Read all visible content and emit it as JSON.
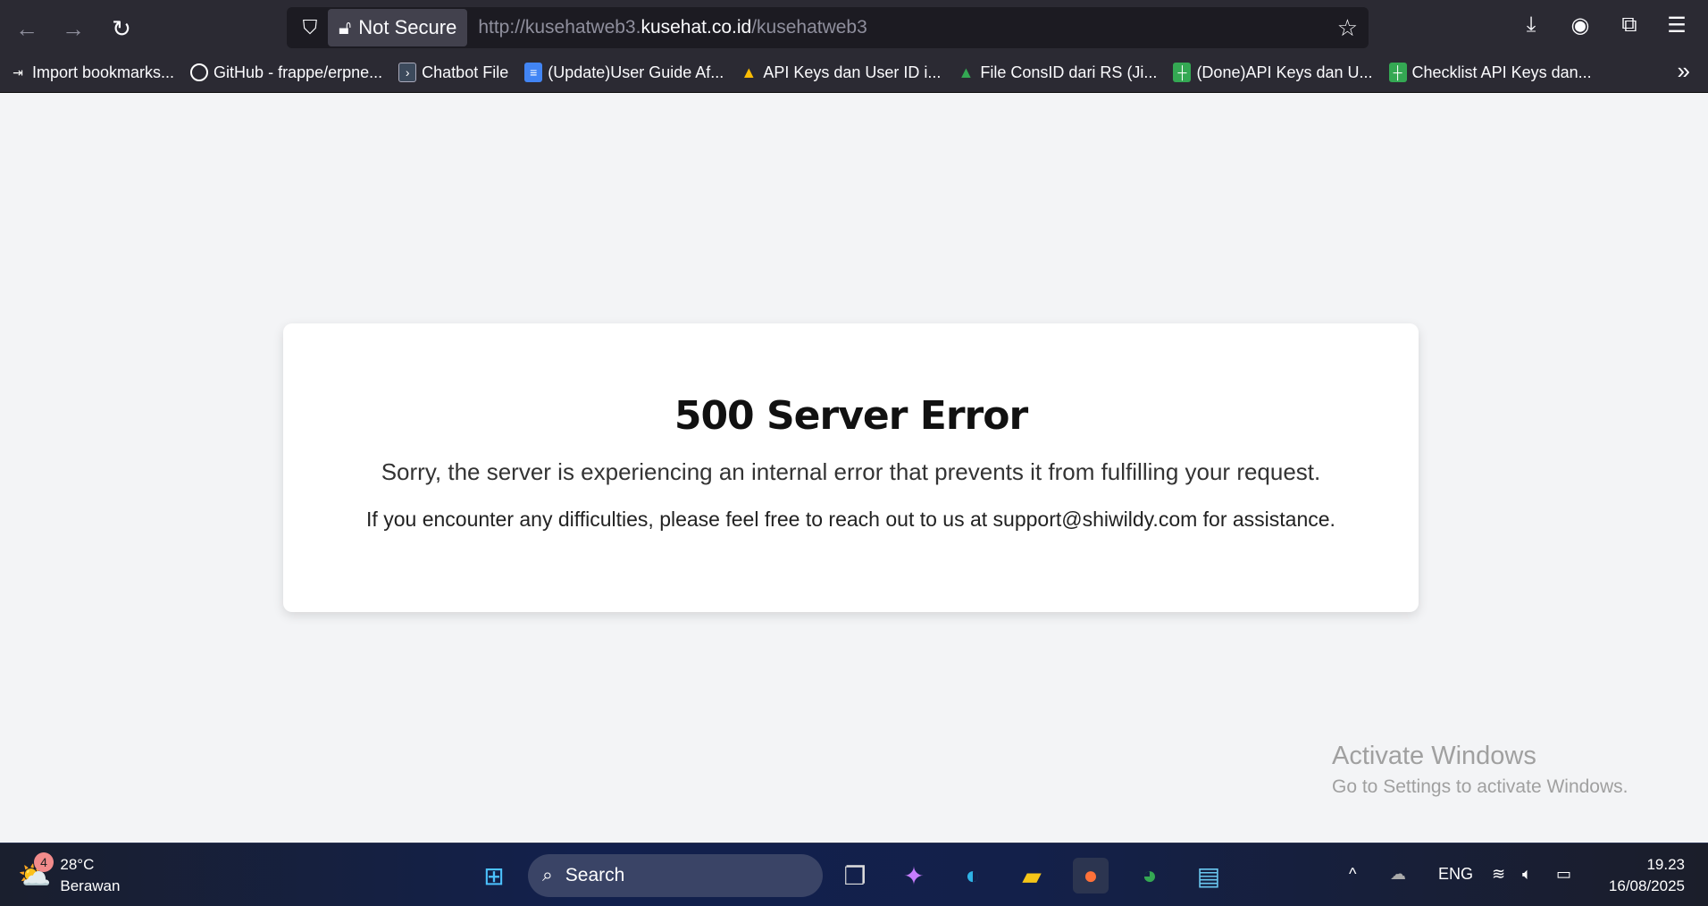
{
  "browser": {
    "security_label": "Not Secure",
    "url_prefix": "http://kusehatweb3.",
    "url_domain": "kusehat.co.id",
    "url_path": "/kusehatweb3",
    "bookmarks": [
      {
        "label": "Import bookmarks...",
        "icon": "import-icon"
      },
      {
        "label": "GitHub - frappe/erpne...",
        "icon": "github-icon"
      },
      {
        "label": "Chatbot File",
        "icon": "terminal-icon"
      },
      {
        "label": "(Update)User Guide Af...",
        "icon": "google-docs-icon"
      },
      {
        "label": "API Keys dan User ID i...",
        "icon": "google-drive-icon"
      },
      {
        "label": "File ConsID dari RS (Ji...",
        "icon": "google-drive-icon"
      },
      {
        "label": "(Done)API Keys dan U...",
        "icon": "google-sheets-icon"
      },
      {
        "label": "Checklist API Keys dan...",
        "icon": "google-sheets-icon"
      }
    ]
  },
  "page": {
    "title": "500 Server Error",
    "message": "Sorry, the server is experiencing an internal error that prevents it from fulfilling your request.",
    "contact": "If you encounter any difficulties, please feel free to reach out to us at support@shiwildy.com for assistance."
  },
  "watermark": {
    "title": "Activate Windows",
    "subtitle": "Go to Settings to activate Windows."
  },
  "taskbar": {
    "weather_badge": "4",
    "temperature": "28°C",
    "condition": "Berawan",
    "search_placeholder": "Search",
    "language": "ENG",
    "time": "19.23",
    "date": "16/08/2025"
  }
}
